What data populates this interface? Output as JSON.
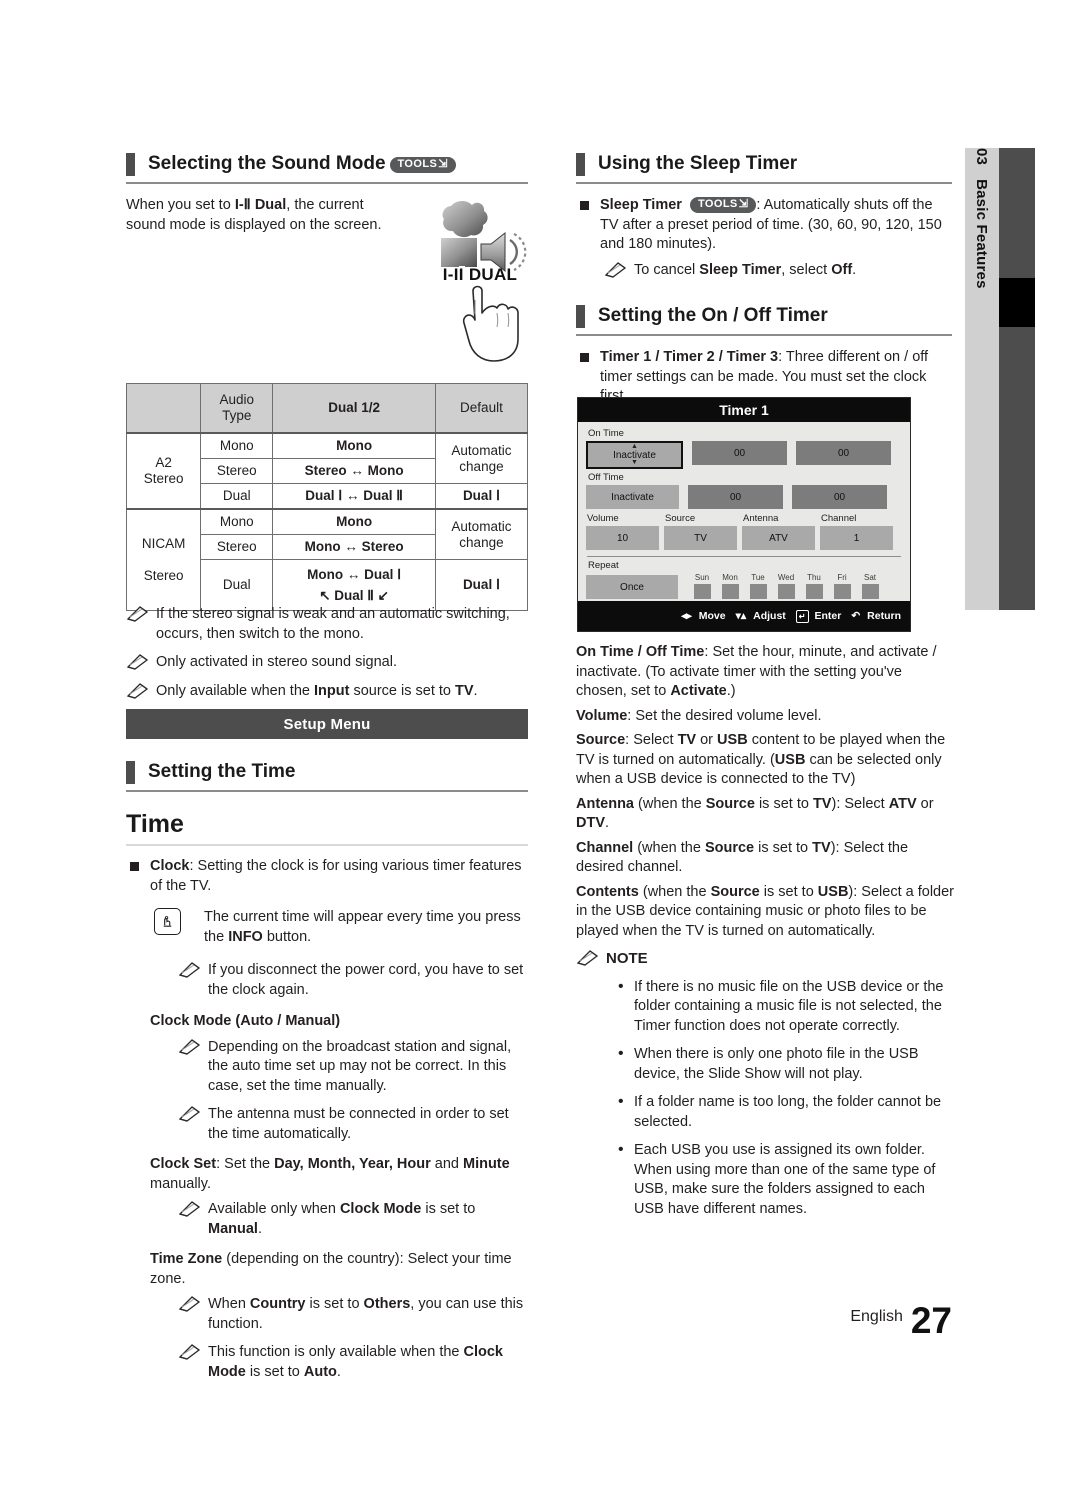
{
  "side_tab": {
    "number": "03",
    "label": "Basic Features"
  },
  "footer": {
    "language": "English",
    "page": "27"
  },
  "left": {
    "section1": {
      "title": "Selecting the Sound Mode",
      "tools_badge": "TOOLS",
      "intro_1": "When you set to ",
      "intro_bold": "I-Ⅱ Dual",
      "intro_2": ", the current sound mode is displayed on the screen.",
      "graphic_label": "I-II DUAL"
    },
    "audio_table": {
      "headers": [
        "",
        "Audio Type",
        "Dual 1/2",
        "Default"
      ],
      "groups": [
        {
          "name": "A2 Stereo",
          "rows": [
            {
              "type": "Mono",
              "dual": "Mono",
              "default": "Automatic change"
            },
            {
              "type": "Stereo",
              "dual": "Stereo ↔ Mono",
              "default": ""
            },
            {
              "type": "Dual",
              "dual": "Dual Ⅰ ↔ Dual Ⅱ",
              "default": "Dual Ⅰ"
            }
          ]
        },
        {
          "name": "NICAM Stereo",
          "rows": [
            {
              "type": "Mono",
              "dual": "Mono",
              "default": "Automatic change"
            },
            {
              "type": "Stereo",
              "dual": "Mono ↔ Stereo",
              "default": ""
            },
            {
              "type": "Dual",
              "dual": "Mono ↔ Dual Ⅰ",
              "dual2": "↖ Dual Ⅱ ↙",
              "default": "Dual Ⅰ"
            }
          ]
        }
      ]
    },
    "notes": [
      "If the stereo signal is weak and an automatic switching, occurs, then switch to the mono.",
      "Only activated in stereo sound signal.",
      "Only available when the Input source is set to TV."
    ],
    "banner": "Setup Menu",
    "section2": {
      "title": "Setting the Time"
    },
    "time_heading": "Time",
    "clock_item": {
      "bold": "Clock",
      "text": ": Setting the clock is for using various timer features of the TV."
    },
    "info_note": {
      "text_1": "The current time will appear every time you press the ",
      "bold": "INFO",
      "text_2": " button."
    },
    "note_powercord": "If you disconnect the power cord, you have to set the clock again.",
    "clock_mode_heading": "Clock Mode (Auto / Manual)",
    "note_broadcast": "Depending on the broadcast station and signal, the auto time set up may not be correct. In this case, set the time manually.",
    "note_antenna": "The antenna must be connected in order to set the time automatically.",
    "clock_set": {
      "bold": "Clock Set",
      "t1": ": Set the ",
      "b2": "Day, Month, Year, Hour",
      "t2": " and ",
      "b3": "Minute",
      "t3": " manually."
    },
    "note_clockmode_manual": {
      "t1": "Available only when ",
      "b1": "Clock Mode",
      "t2": " is set to ",
      "b2": "Manual",
      "t3": "."
    },
    "time_zone": {
      "bold": "Time Zone",
      "text": " (depending on the country): Select your time zone."
    },
    "note_country": {
      "t1": "When ",
      "b1": "Country",
      "t2": " is set to ",
      "b2": "Others",
      "t3": ", you can use this function."
    },
    "note_auto": {
      "t1": "This function is only available when the ",
      "b1": "Clock Mode",
      "t2": " is set to ",
      "b2": "Auto",
      "t3": "."
    }
  },
  "right": {
    "section1": {
      "title": "Using the Sleep Timer",
      "item_bold": "Sleep Timer",
      "tools_badge": "TOOLS",
      "item_text": ": Automatically shuts off the TV after a preset period of time. (30, 60, 90, 120, 150 and 180 minutes).",
      "note": {
        "t1": "To cancel ",
        "b1": "Sleep Timer",
        "t2": ", select ",
        "b2": "Off",
        "t3": "."
      }
    },
    "section2": {
      "title": "Setting the On / Off Timer",
      "item_bold": "Timer 1 / Timer 2 / Timer 3",
      "item_text": ": Three different on / off timer settings can be made. You must set the clock first."
    },
    "osd": {
      "title": "Timer 1",
      "on_time_label": "On Time",
      "on_time": [
        "Inactivate",
        "00",
        "00"
      ],
      "off_time_label": "Off Time",
      "off_time": [
        "Inactivate",
        "00",
        "00"
      ],
      "quad_labels": [
        "Volume",
        "Source",
        "Antenna",
        "Channel"
      ],
      "quad_values": [
        "10",
        "TV",
        "ATV",
        "1"
      ],
      "repeat_label": "Repeat",
      "repeat_value": "Once",
      "days": [
        "Sun",
        "Mon",
        "Tue",
        "Wed",
        "Thu",
        "Fri",
        "Sat"
      ],
      "footer": [
        "Move",
        "Adjust",
        "Enter",
        "Return"
      ]
    },
    "descriptions": [
      {
        "bold": "On Time / Off Time",
        "t1": ": Set the hour, minute, and activate / inactivate. (To activate timer with the setting you've chosen, set to ",
        "b2": "Activate",
        "t2": ".)"
      },
      {
        "bold": "Volume",
        "t1": ": Set the desired volume level."
      },
      {
        "bold": "Source",
        "t1": ": Select TV or USB content to be played when the TV is turned on automatically. (USB can be selected only when a USB device is connected to the TV)"
      },
      {
        "bold": "Antenna",
        "t1": " (when the Source is set to TV): Select ATV or DTV."
      },
      {
        "bold": "Channel",
        "t1": " (when the Source is set to TV): Select the desired channel."
      },
      {
        "bold": "Contents",
        "t1": " (when the Source is set to USB): Select a folder in the USB device containing music or photo files to be played when the TV is turned on automatically."
      }
    ],
    "note_heading": "NOTE",
    "note_bullets": [
      "If there is no music file on the USB device or the folder containing a music file is not selected, the Timer function does not operate correctly.",
      "When there is only one photo file in the USB device, the Slide Show will not play.",
      "If a folder name is too long, the folder cannot be selected.",
      "Each USB you use is assigned its own folder. When using more than one of the same type of USB, make sure the folders assigned to each USB have different names."
    ]
  }
}
